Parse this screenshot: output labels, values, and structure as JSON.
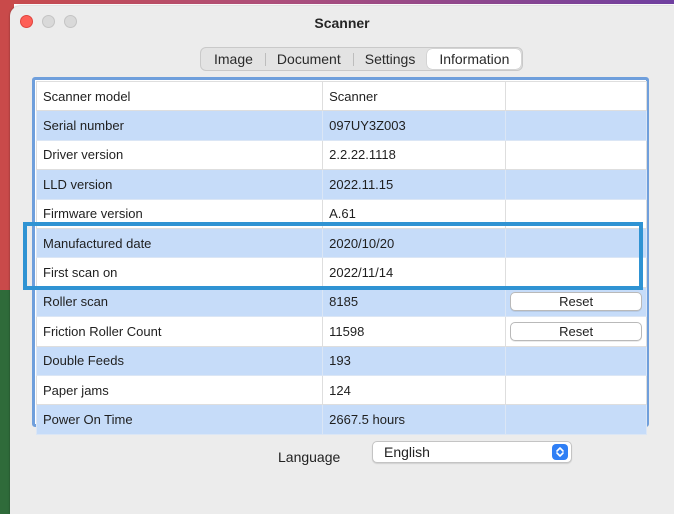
{
  "window": {
    "title": "Scanner"
  },
  "tabs": [
    {
      "label": "Image",
      "active": false
    },
    {
      "label": "Document",
      "active": false
    },
    {
      "label": "Settings",
      "active": false
    },
    {
      "label": "Information",
      "active": true
    }
  ],
  "info": {
    "rows": [
      {
        "label": "Scanner model",
        "value": "Scanner"
      },
      {
        "label": "Serial number",
        "value": "097UY3Z003"
      },
      {
        "label": "Driver version",
        "value": "2.2.22.1118"
      },
      {
        "label": "LLD version",
        "value": "2022.11.15"
      },
      {
        "label": "Firmware version",
        "value": "A.61"
      },
      {
        "label": "Manufactured date",
        "value": "2020/10/20"
      },
      {
        "label": "First scan on",
        "value": "2022/11/14"
      },
      {
        "label": "Roller scan",
        "value": "8185",
        "action": "Reset"
      },
      {
        "label": "Friction Roller Count",
        "value": "11598",
        "action": "Reset"
      },
      {
        "label": "Double Feeds",
        "value": "193"
      },
      {
        "label": "Paper jams",
        "value": "124"
      },
      {
        "label": "Power On Time",
        "value": "2667.5 hours"
      }
    ]
  },
  "language": {
    "label": "Language",
    "selected": "English"
  },
  "colors": {
    "accent": "#2f93d3",
    "row_alt": "#c6dcf9",
    "panel_border": "#6f9fdc",
    "close_button": "#fe5f57",
    "stepper": "#2f7ff5"
  },
  "icons": {
    "language_select": "chevron-up-down-icon"
  }
}
